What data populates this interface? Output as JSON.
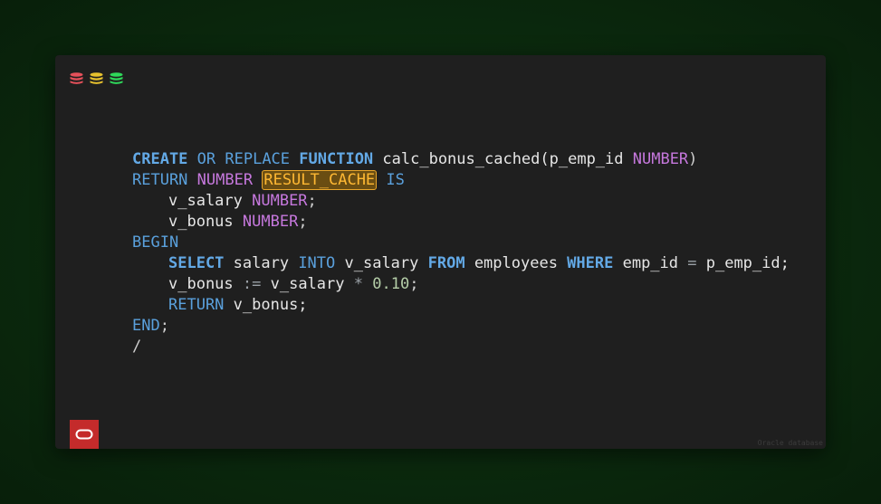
{
  "window": {
    "icons": [
      {
        "name": "database-icon",
        "color": "#e5505a"
      },
      {
        "name": "database-icon",
        "color": "#e7c12e"
      },
      {
        "name": "database-icon",
        "color": "#2fd85a"
      }
    ]
  },
  "code": {
    "line1": {
      "t1": "CREATE",
      "t2": " ",
      "t3": "OR REPLACE",
      "t4": " ",
      "t5": "FUNCTION",
      "t6": " calc_bonus_cached(p_emp_id ",
      "t7": "NUMBER",
      "t8": ")"
    },
    "line2": {
      "t1": "RETURN",
      "t2": " ",
      "t3": "NUMBER",
      "t4": " ",
      "t5": "RESULT_CACHE",
      "t6": " ",
      "t7": "IS"
    },
    "line3": {
      "t1": "v_salary ",
      "t2": "NUMBER",
      "t3": ";"
    },
    "line4": {
      "t1": "v_bonus ",
      "t2": "NUMBER",
      "t3": ";"
    },
    "line5": {
      "t1": "BEGIN"
    },
    "line6": {
      "t1": "SELECT",
      "t2": " salary ",
      "t3": "INTO",
      "t4": " v_salary ",
      "t5": "FROM",
      "t6": " employees ",
      "t7": "WHERE",
      "t8": " emp_id ",
      "t9": "=",
      "t10": " p_emp_id;"
    },
    "line7": {
      "t1": "v_bonus ",
      "t2": ":=",
      "t3": " v_salary ",
      "t4": "*",
      "t5": " ",
      "t6": "0.10",
      "t7": ";"
    },
    "line8": {
      "t1": "RETURN",
      "t2": " v_bonus;"
    },
    "line9": {
      "t1": "END",
      "t2": ";"
    },
    "line10": {
      "t1": "/"
    }
  },
  "footer": {
    "label": "Oracle database",
    "logo": "oracle-logo-icon",
    "logo_color": "#c42b2b"
  },
  "colors": {
    "keyword": "#63a9e6",
    "type": "#c678dd",
    "number": "#b5cea8",
    "highlight": "#ffb833"
  }
}
